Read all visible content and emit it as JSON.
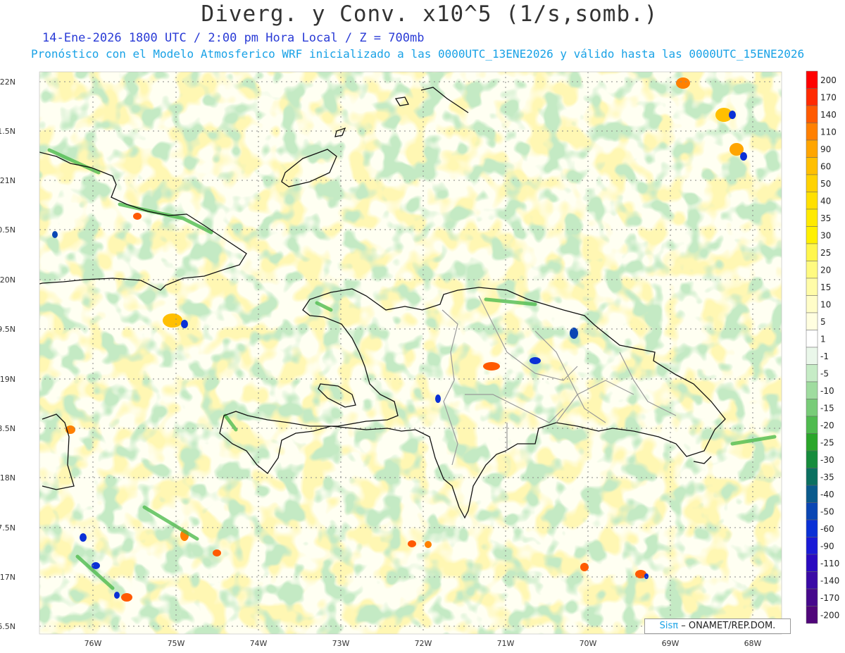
{
  "header": {
    "title": "Diverg. y Conv. x10^5 (1/s,somb.)",
    "subtitle_time": "14-Ene-2026  1800 UTC / 2:00 pm Hora Local / Z = 700mb",
    "subtitle_model": "Pronóstico con el Modelo Atmosferico WRF inicializado a las 0000UTC_13ENE2026 y válido hasta las  0000UTC_15ENE2026"
  },
  "map": {
    "lat_labels": [
      "22N",
      "1.5N",
      "21N",
      "0.5N",
      "20N",
      "9.5N",
      "19N",
      "8.5N",
      "18N",
      "7.5N",
      "17N",
      "6.5N"
    ],
    "lon_labels": [
      "76W",
      "75W",
      "74W",
      "73W",
      "72W",
      "71W",
      "70W",
      "69W",
      "68W"
    ],
    "credit_sis": "Sisπ",
    "credit_org": "– ONAMET/REP.DOM."
  },
  "colorbar": {
    "labels": [
      "200",
      "170",
      "140",
      "110",
      "90",
      "60",
      "50",
      "40",
      "35",
      "30",
      "25",
      "20",
      "15",
      "10",
      "5",
      "1",
      "-1",
      "-5",
      "-10",
      "-15",
      "-20",
      "-25",
      "-30",
      "-35",
      "-40",
      "-50",
      "-60",
      "-90",
      "-110",
      "-140",
      "-170",
      "-200"
    ],
    "colors": [
      "#ff0000",
      "#ff2a00",
      "#ff5a00",
      "#ff8000",
      "#ffa500",
      "#ffbf00",
      "#ffd200",
      "#ffe000",
      "#ffea00",
      "#fff000",
      "#fff64d",
      "#fffa80",
      "#fffca8",
      "#fffdc8",
      "#fffee0",
      "#ffffff",
      "#eaf7ea",
      "#c6ecc6",
      "#9fdc9f",
      "#78cc78",
      "#4fbb4f",
      "#2aa62a",
      "#168c3c",
      "#0b7060",
      "#0a5a8c",
      "#0a46b4",
      "#0a30d6",
      "#1a1ad6",
      "#2a0ac0",
      "#3a0aa6",
      "#46088c",
      "#50067a"
    ]
  }
}
